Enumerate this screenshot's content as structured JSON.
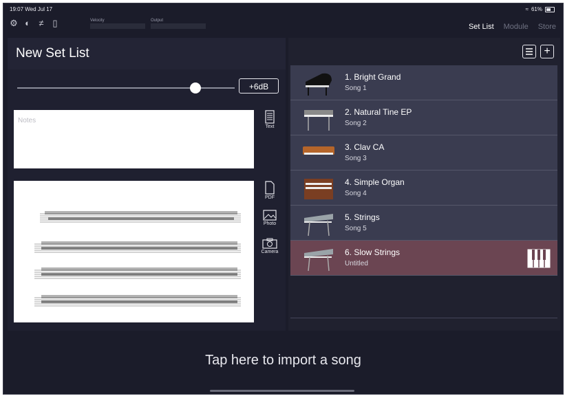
{
  "status": {
    "time": "19:07  Wed Jul 17",
    "battery": "61%"
  },
  "toolbar": {
    "velocity_label": "Velocity",
    "output_label": "Output"
  },
  "tabs": [
    {
      "label": "Set List",
      "active": true
    },
    {
      "label": "Module",
      "active": false
    },
    {
      "label": "Store",
      "active": false
    }
  ],
  "setlist": {
    "title": "New Set List",
    "volume_button": "+6dB",
    "volume_level": 0.82,
    "notes_placeholder": "Notes"
  },
  "attach_tools": [
    {
      "label": "Text",
      "icon": "text-document-icon"
    },
    {
      "label": "PDF",
      "icon": "pdf-document-icon"
    },
    {
      "label": "Photo",
      "icon": "photo-icon"
    },
    {
      "label": "Camera",
      "icon": "camera-icon"
    }
  ],
  "songs": [
    {
      "name": "1. Bright Grand",
      "sub": "Song 1",
      "icon": "grand-piano-icon"
    },
    {
      "name": "2. Natural Tine EP",
      "sub": "Song 2",
      "icon": "electric-piano-icon"
    },
    {
      "name": "3. Clav CA",
      "sub": "Song 3",
      "icon": "clavinet-icon"
    },
    {
      "name": "4. Simple Organ",
      "sub": "Song 4",
      "icon": "organ-icon"
    },
    {
      "name": "5. Strings",
      "sub": "Song 5",
      "icon": "strings-keyboard-icon"
    },
    {
      "name": "6. Slow Strings",
      "sub": "Untitled",
      "icon": "strings-keyboard-icon",
      "selected": true
    }
  ],
  "footer": {
    "import_text": "Tap here to import a song"
  },
  "colors": {
    "background": "#1b1c2a",
    "song_row": "#3a3c50",
    "selected_row": "#6b4552"
  }
}
